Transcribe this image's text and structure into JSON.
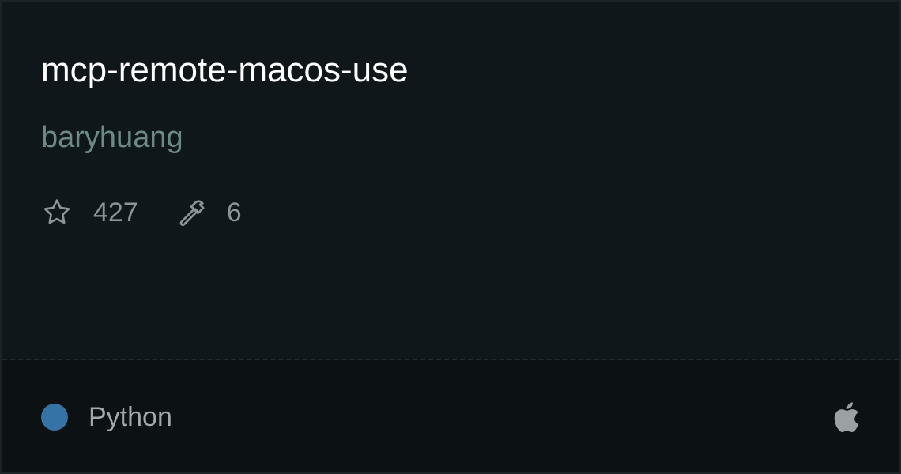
{
  "repo": {
    "name": "mcp-remote-macos-use",
    "owner": "baryhuang"
  },
  "stats": {
    "stars": "427",
    "star_icon": "star-icon",
    "tools": "6",
    "tools_icon": "hammer-icon"
  },
  "language": {
    "name": "Python",
    "color": "#3572A5"
  },
  "platform": {
    "icon": "apple-icon"
  }
}
